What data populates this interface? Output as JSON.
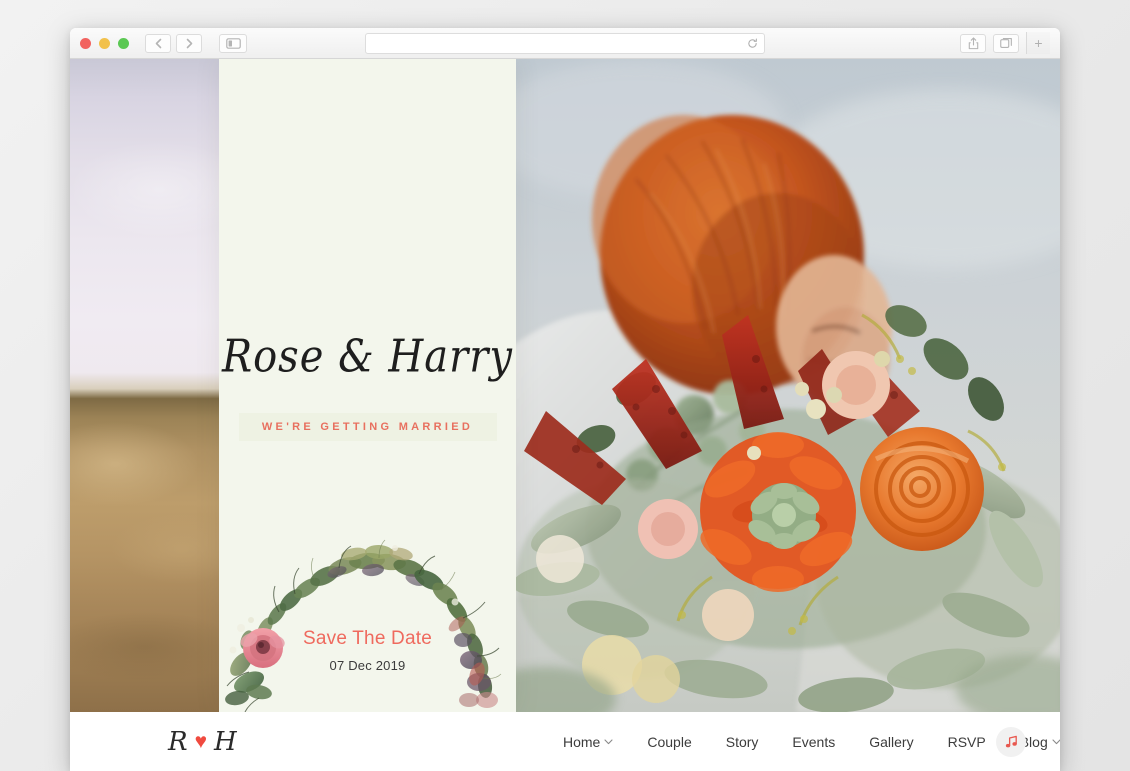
{
  "browser": {
    "traffic_lights": [
      "close",
      "minimize",
      "maximize"
    ],
    "back_label": "Back",
    "forward_label": "Forward",
    "sidebar_label": "Show Sidebar",
    "address_value": "",
    "address_placeholder": "",
    "reload_label": "Reload",
    "share_label": "Share",
    "tabs_label": "Show Tab Overview",
    "new_tab_label": "+"
  },
  "hero": {
    "couple_names": "Rose & Harry",
    "tagline": "WE'RE GETTING MARRIED",
    "save_the_date": "Save The Date",
    "date": "07 Dec 2019"
  },
  "nav": {
    "logo": {
      "left_initial": "R",
      "heart": "♥",
      "right_initial": "H"
    },
    "items": [
      {
        "label": "Home",
        "has_dropdown": true
      },
      {
        "label": "Couple",
        "has_dropdown": false
      },
      {
        "label": "Story",
        "has_dropdown": false
      },
      {
        "label": "Events",
        "has_dropdown": false
      },
      {
        "label": "Gallery",
        "has_dropdown": false
      },
      {
        "label": "RSVP",
        "has_dropdown": false
      },
      {
        "label": "Blog",
        "has_dropdown": true
      }
    ],
    "music_label": "Play music"
  },
  "colors": {
    "accent": "#ef6a5e",
    "tagline": "#e8705f",
    "heart": "#f04a3f",
    "card_bg": "#f3f6ec",
    "band_bg": "#eef2e3",
    "nav_bg": "#ffffff",
    "text": "#3c3c3c"
  }
}
